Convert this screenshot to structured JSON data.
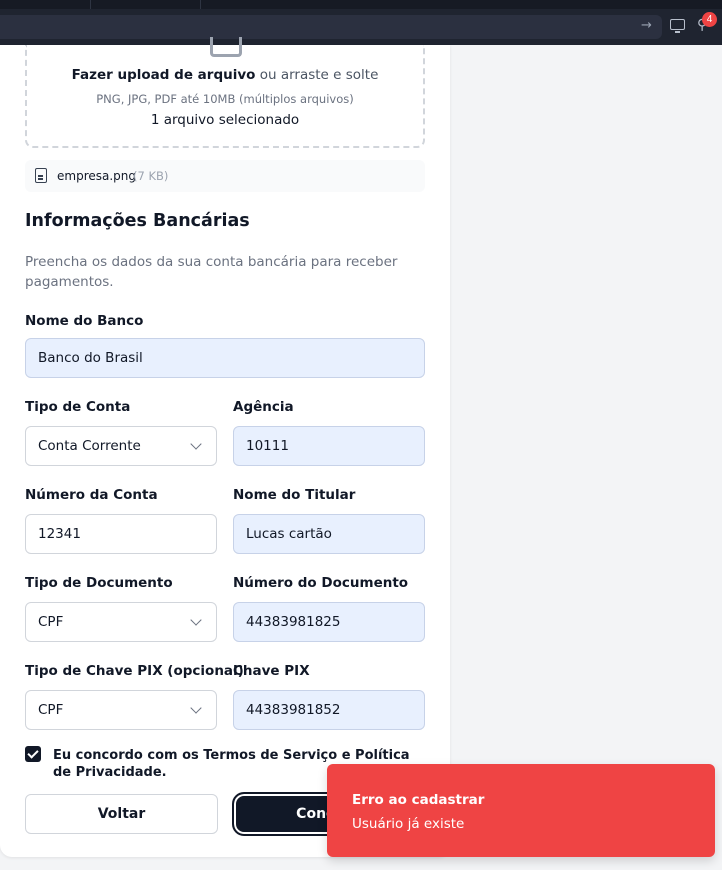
{
  "topbar": {
    "notification_count": "4"
  },
  "upload": {
    "action_text": "Fazer upload de arquivo",
    "drag_text": " ou arraste e solte",
    "formats": "PNG, JPG, PDF até 10MB (múltiplos arquivos)",
    "status": "1 arquivo selecionado"
  },
  "file": {
    "name": "empresa.png",
    "size": "(7 KB)"
  },
  "bank_section": {
    "title": "Informações Bancárias",
    "description": "Preencha os dados da sua conta bancária para receber pagamentos."
  },
  "fields": {
    "bank_name": {
      "label": "Nome do Banco",
      "value": "Banco do Brasil"
    },
    "account_type": {
      "label": "Tipo de Conta",
      "value": "Conta Corrente"
    },
    "agency": {
      "label": "Agência",
      "value": "10111"
    },
    "account_number": {
      "label": "Número da Conta",
      "value": "12341"
    },
    "holder_name": {
      "label": "Nome do Titular",
      "value": "Lucas cartão"
    },
    "document_type": {
      "label": "Tipo de Documento",
      "value": "CPF"
    },
    "document_number": {
      "label": "Número do Documento",
      "value": "44383981825"
    },
    "pix_type": {
      "label": "Tipo de Chave PIX (opcional)",
      "value": "CPF"
    },
    "pix_key": {
      "label": "Chave PIX",
      "value": "44383981852"
    }
  },
  "terms": {
    "text": "Eu concordo com os Termos de Serviço e Política de Privacidade.",
    "checked": true
  },
  "buttons": {
    "back": "Voltar",
    "finish": "Concluir"
  },
  "toast": {
    "title": "Erro ao cadastrar",
    "message": "Usuário já existe",
    "color": "#ef4444"
  }
}
